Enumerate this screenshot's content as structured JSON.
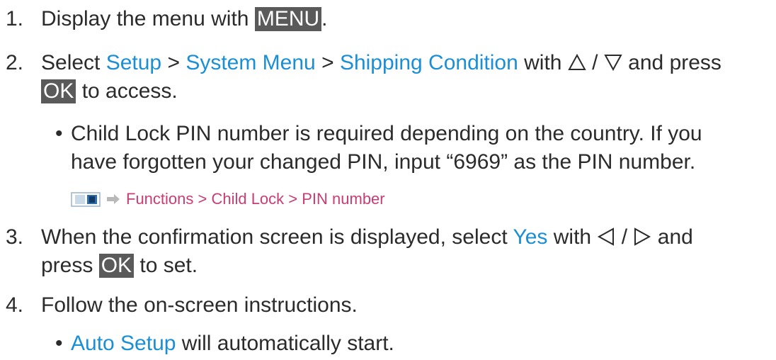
{
  "steps": [
    {
      "num": "1.",
      "text_a": "Display the menu with ",
      "key": "MENU",
      "text_b": "."
    },
    {
      "num": "2.",
      "text_a": "Select ",
      "link1": "Setup",
      "sep1": " > ",
      "link2": "System Menu",
      "sep2": " > ",
      "link3": "Shipping Condition",
      "text_b": " with ",
      "slash": " / ",
      "text_c": " and press",
      "key": "OK",
      "text_d": " to access."
    },
    {
      "num": "3.",
      "text_a": "When the confirmation screen is displayed, select ",
      "link": "Yes",
      "text_b": " with ",
      "slash": " / ",
      "text_c": " and",
      "text_d": "press ",
      "key": "OK",
      "text_e": " to set."
    },
    {
      "num": "4.",
      "text_a": "Follow the on-screen instructions."
    }
  ],
  "notes": {
    "pin_line1": "Child Lock PIN number is required depending on the country. If you",
    "pin_line2": "have forgotten your changed PIN, input “6969” as the PIN number.",
    "auto_link": "Auto Setup",
    "auto_text": " will automatically start."
  },
  "reference": {
    "icon": "tv-menu-icon",
    "arrow_icon": "right-arrow-icon",
    "path": "Functions > Child Lock > PIN number"
  },
  "icons": {
    "up": "up-triangle-icon",
    "down": "down-triangle-icon",
    "left": "left-triangle-icon",
    "right": "right-triangle-icon"
  },
  "colors": {
    "link": "#1b8fd6",
    "reference": "#c93d73",
    "key_bg": "#5a5a5a",
    "text": "#2b2b2b"
  }
}
